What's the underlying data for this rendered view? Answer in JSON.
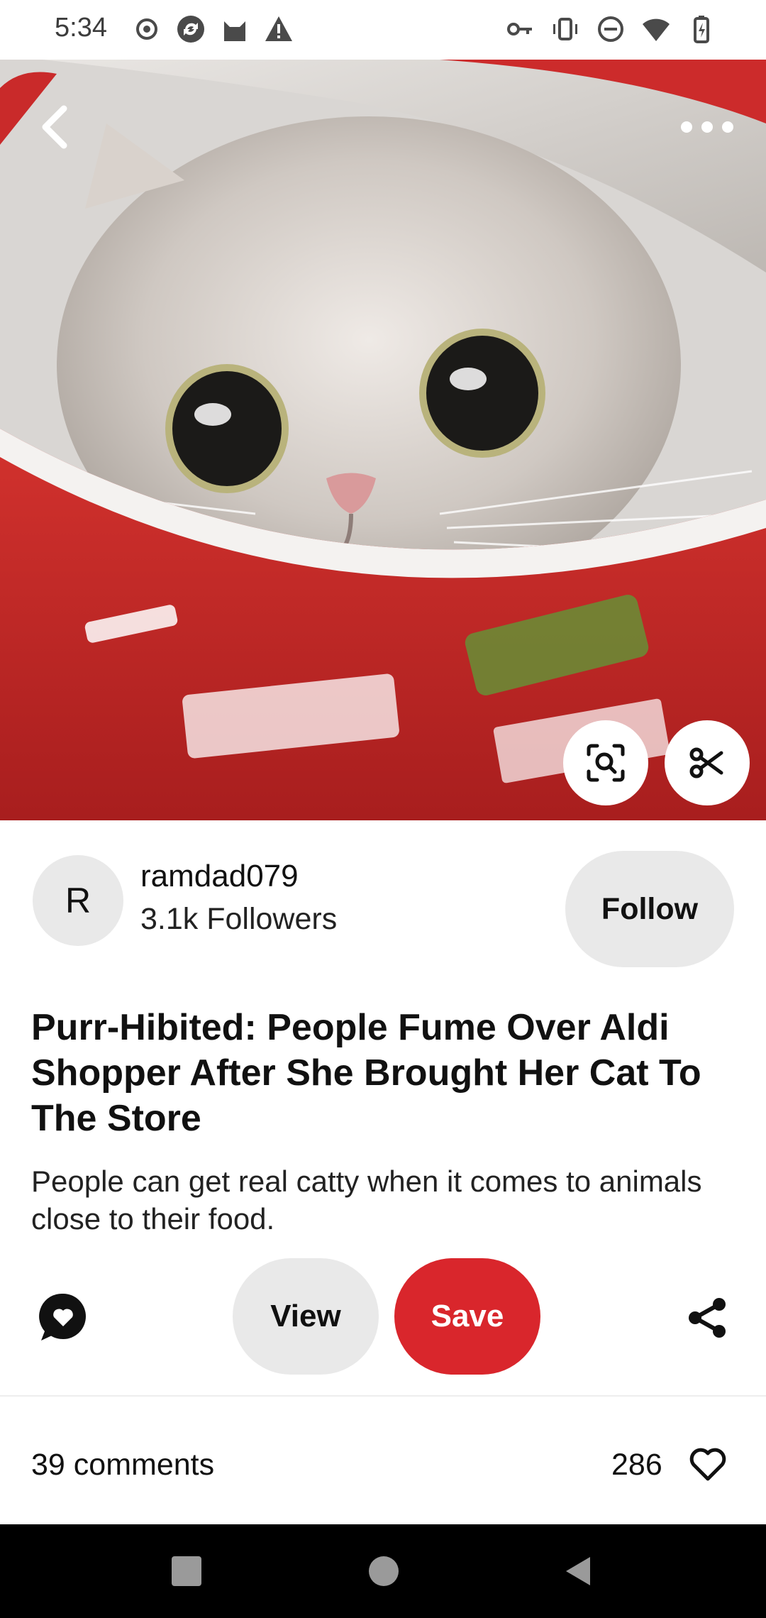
{
  "status_bar": {
    "time": "5:34",
    "left_icons": [
      "record-icon",
      "sync-icon",
      "cat-icon",
      "alert-icon"
    ],
    "right_icons": [
      "key-icon",
      "vibrate-icon",
      "do-not-disturb-icon",
      "wifi-icon",
      "battery-icon"
    ]
  },
  "pin_image": {
    "back_icon": "chevron-left-icon",
    "more_icon": "more-horizontal-icon",
    "lens_icon": "visual-search-icon",
    "cutout_icon": "scissors-icon"
  },
  "creator": {
    "avatar_initial": "R",
    "username": "ramdad079",
    "followers": "3.1k Followers",
    "follow_label": "Follow"
  },
  "pin": {
    "title": "Purr-Hibited: People Fume Over Aldi Shopper After She Brought Her Cat To The Store",
    "description": "People can get real catty when it comes to animals close to their food."
  },
  "actions": {
    "comment_icon": "comment-heart-icon",
    "view_label": "View",
    "save_label": "Save",
    "share_icon": "share-icon"
  },
  "engagement": {
    "comments": "39 comments",
    "likes": "286",
    "like_icon": "heart-outline-icon"
  },
  "colors": {
    "save_red": "#d9262c",
    "pill_gray": "#e9e9e9"
  }
}
